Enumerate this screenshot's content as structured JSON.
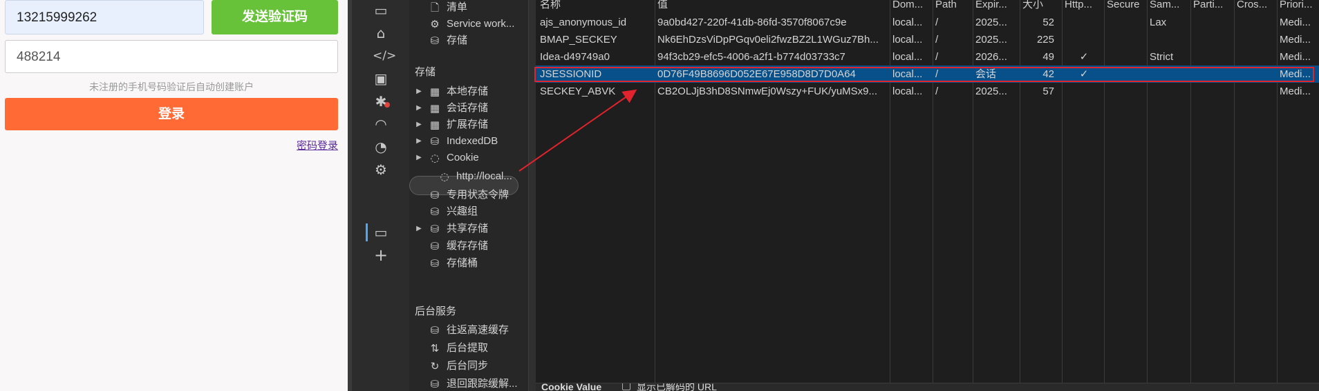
{
  "login": {
    "phone": "13215999262",
    "send_code": "发送验证码",
    "code": "488214",
    "hint": "未注册的手机号码验证后自动创建账户",
    "login_btn": "登录",
    "pwd_login": "密码登录"
  },
  "tree": {
    "top_items": [
      {
        "label": "清单",
        "icon": "file-icon"
      },
      {
        "label": "Service work...",
        "icon": "gear-file-icon"
      },
      {
        "label": "存储",
        "icon": "database-icon"
      }
    ],
    "storage_section": "存储",
    "storage_items": [
      {
        "label": "本地存储",
        "icon": "grid-icon",
        "expand": true
      },
      {
        "label": "会话存储",
        "icon": "grid-icon",
        "expand": true
      },
      {
        "label": "扩展存储",
        "icon": "grid-icon",
        "expand": true
      },
      {
        "label": "IndexedDB",
        "icon": "database-icon",
        "expand": true
      },
      {
        "label": "Cookie",
        "icon": "cookie-icon",
        "expand": true
      },
      {
        "label": "http://local...",
        "icon": "cookie-icon",
        "expand": false,
        "selected": true
      },
      {
        "label": "专用状态令牌",
        "icon": "database-icon",
        "expand": false
      },
      {
        "label": "兴趣组",
        "icon": "database-icon",
        "expand": false
      },
      {
        "label": "共享存储",
        "icon": "database-icon",
        "expand": true
      },
      {
        "label": "缓存存储",
        "icon": "database-icon",
        "expand": false
      },
      {
        "label": "存储桶",
        "icon": "database-icon",
        "expand": false
      }
    ],
    "background_section": "后台服务",
    "background_items": [
      {
        "label": "往返高速缓存",
        "icon": "database-icon"
      },
      {
        "label": "后台提取",
        "icon": "updown-arrows-icon"
      },
      {
        "label": "后台同步",
        "icon": "sync-icon"
      },
      {
        "label": "退回跟踪缓解...",
        "icon": "database-icon"
      }
    ]
  },
  "columns": [
    "名称",
    "值",
    "Dom...",
    "Path",
    "Expir...",
    "大小",
    "Http...",
    "Secure",
    "Sam...",
    "Parti...",
    "Cros...",
    "Priori..."
  ],
  "rows": [
    [
      "ajs_anonymous_id",
      "9a0bd427-220f-41db-86fd-3570f8067c9e",
      "local...",
      "/",
      "2025...",
      "52",
      "",
      "",
      "Lax",
      "",
      "",
      "Medi..."
    ],
    [
      "BMAP_SECKEY",
      "Nk6EhDzsViDpPGqv0eli2fwzBZ2L1WGuz7Bh...",
      "local...",
      "/",
      "2025...",
      "225",
      "",
      "",
      "",
      "",
      "",
      "Medi..."
    ],
    [
      "Idea-d49749a0",
      "94f3cb29-efc5-4006-a2f1-b774d03733c7",
      "local...",
      "/",
      "2026...",
      "49",
      "✓",
      "",
      "Strict",
      "",
      "",
      "Medi..."
    ],
    [
      "JSESSIONID",
      "0D76F49B8696D052E67E958D8D7D0A64",
      "local...",
      "/",
      "会话",
      "42",
      "✓",
      "",
      "",
      "",
      "",
      "Medi..."
    ],
    [
      "SECKEY_ABVK",
      "CB2OLJjB3hD8SNmwEj0Wszy+FUK/yuMSx9...",
      "local...",
      "/",
      "2025...",
      "57",
      "",
      "",
      "",
      "",
      "",
      "Medi..."
    ]
  ],
  "selected_row": 3,
  "bottom": {
    "title": "Cookie Value",
    "checkbox_label": "显示已解码的 URL"
  },
  "colors": {
    "annotation": "#e0232c",
    "selection": "#08508a",
    "accent_green": "#67c23a",
    "accent_orange": "#ff6a35"
  }
}
